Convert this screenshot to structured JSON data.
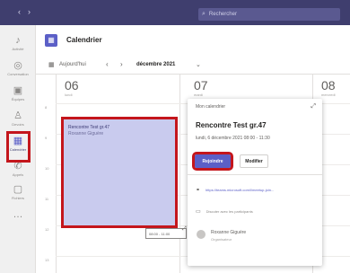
{
  "titlebar": {
    "back_glyph": "‹",
    "forward_glyph": "›",
    "search_placeholder": "Rechercher",
    "search_icon": "search-icon"
  },
  "rail": {
    "items": [
      {
        "icon": "bell-icon",
        "glyph": "♪",
        "label": "Activité"
      },
      {
        "icon": "chat-icon",
        "glyph": "◎",
        "label": "Conversation"
      },
      {
        "icon": "teams-icon",
        "glyph": "▣",
        "label": "Équipes"
      },
      {
        "icon": "assignments-icon",
        "glyph": "♙",
        "label": "Devoirs"
      },
      {
        "icon": "calendar-icon",
        "glyph": "▦",
        "label": "Calendrier"
      },
      {
        "icon": "calls-icon",
        "glyph": "✆",
        "label": "Appels"
      },
      {
        "icon": "files-icon",
        "glyph": "▢",
        "label": "Fichiers"
      },
      {
        "icon": "more-icon",
        "glyph": "…",
        "label": ""
      }
    ]
  },
  "header": {
    "title": "Calendrier",
    "icon": "calendar-icon"
  },
  "toolbar": {
    "today_label": "Aujourd'hui",
    "prev_glyph": "‹",
    "next_glyph": "›",
    "month_label": "décembre 2021",
    "caret_glyph": "⌄"
  },
  "days": [
    {
      "num": "06",
      "name": "lundi"
    },
    {
      "num": "07",
      "name": "mardi"
    },
    {
      "num": "08",
      "name": "mercredi"
    }
  ],
  "hours": [
    "8",
    "9",
    "10",
    "11",
    "12",
    "13"
  ],
  "event": {
    "title": "Rencontre Test gr.47",
    "organizer": "Roxanne Giguère"
  },
  "time_tooltip": "08:00 - 11:00",
  "popup": {
    "calendar_name": "Mon calendrier",
    "title": "Rencontre Test gr.47",
    "when": "lundi, 6 décembre 2021 08:00 - 11:30",
    "join_label": "Rejoindre",
    "edit_label": "Modifier",
    "link_text": "https://teams.microsoft.com/l/meetup-join...",
    "chat_text": "Discuter avec les participants",
    "organizer_name": "Roxanne Giguère",
    "organizer_role": "Organisateur"
  },
  "colors": {
    "accent": "#5b5fc7",
    "titlebar": "#3f3e6e",
    "highlight": "#c4161c",
    "event_bg": "#c9cbee"
  }
}
